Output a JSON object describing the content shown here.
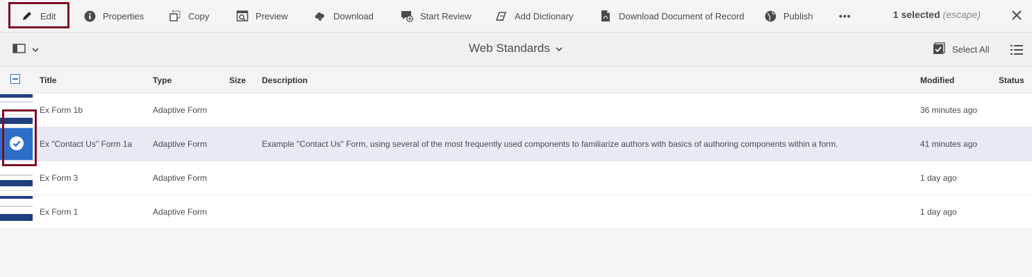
{
  "toolbar": {
    "items": [
      {
        "label": "Edit",
        "icon": "pencil-icon"
      },
      {
        "label": "Properties",
        "icon": "info-icon"
      },
      {
        "label": "Copy",
        "icon": "copy-icon"
      },
      {
        "label": "Preview",
        "icon": "preview-icon"
      },
      {
        "label": "Download",
        "icon": "cloud-download-icon"
      },
      {
        "label": "Start Review",
        "icon": "review-icon"
      },
      {
        "label": "Add Dictionary",
        "icon": "dictionary-icon"
      },
      {
        "label": "Download Document of Record",
        "icon": "pdf-icon"
      },
      {
        "label": "Publish",
        "icon": "globe-icon"
      }
    ],
    "more": "•••",
    "selected_count": "1 selected",
    "escape_hint": "(escape)"
  },
  "subbar": {
    "collection_title": "Web Standards",
    "select_all": "Select All"
  },
  "table": {
    "columns": [
      "Title",
      "Type",
      "Size",
      "Description",
      "Modified",
      "Status"
    ],
    "rows": [
      {
        "title": "Ex Form 1b",
        "type": "Adaptive Form",
        "size": "",
        "description": "",
        "modified": "36 minutes ago",
        "status": "",
        "selected": false
      },
      {
        "title": "Ex \"Contact Us\" Form 1a",
        "type": "Adaptive Form",
        "size": "",
        "description": "Example \"Contact Us\" Form, using several of the most frequently used components to familiarize authors with basics of authoring components within a form.",
        "modified": "41 minutes ago",
        "status": "",
        "selected": true
      },
      {
        "title": "Ex Form 3",
        "type": "Adaptive Form",
        "size": "",
        "description": "",
        "modified": "1 day ago",
        "status": "",
        "selected": false
      },
      {
        "title": "Ex Form 1",
        "type": "Adaptive Form",
        "size": "",
        "description": "",
        "modified": "1 day ago",
        "status": "",
        "selected": false
      }
    ]
  },
  "colors": {
    "accent_blue": "#2d6ec9",
    "highlight_border": "#7a0f23",
    "selected_row": "#e6eaf1"
  }
}
